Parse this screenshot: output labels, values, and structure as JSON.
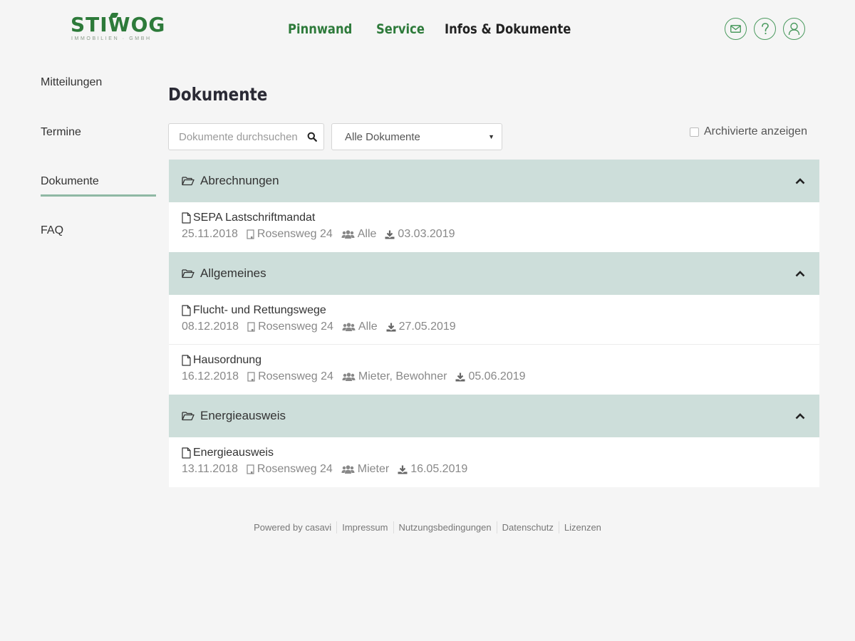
{
  "brand": {
    "logo_text": "STIWOG",
    "logo_subtext": "IMMOBILIEN · GMBH",
    "color": "#2d7a3a"
  },
  "topnav": {
    "items": [
      {
        "label": "Pinnwand"
      },
      {
        "label": "Service"
      },
      {
        "label": "Infos & Dokumente",
        "active": true
      }
    ]
  },
  "header_icons": [
    "mail-icon",
    "help-icon",
    "user-icon"
  ],
  "sidebar": {
    "items": [
      {
        "label": "Mitteilungen"
      },
      {
        "label": "Termine"
      },
      {
        "label": "Dokumente",
        "active": true
      },
      {
        "label": "FAQ"
      }
    ]
  },
  "main": {
    "title": "Dokumente",
    "search": {
      "placeholder": "Dokumente durchsuchen",
      "value": ""
    },
    "filter": {
      "selected": "Alle Dokumente"
    },
    "archive_label": "Archivierte anzeigen",
    "archive_checked": false
  },
  "groups": [
    {
      "name": "Abrechnungen",
      "docs": [
        {
          "title": "SEPA Lastschriftmandat",
          "date": "25.11.2018",
          "property": "Rosensweg 24",
          "audience": "Alle",
          "download": "03.03.2019"
        }
      ]
    },
    {
      "name": "Allgemeines",
      "docs": [
        {
          "title": "Flucht- und Rettungswege",
          "date": "08.12.2018",
          "property": "Rosensweg 24",
          "audience": "Alle",
          "download": "27.05.2019"
        },
        {
          "title": "Hausordnung",
          "date": "16.12.2018",
          "property": "Rosensweg 24",
          "audience": "Mieter, Bewohner",
          "download": "05.06.2019"
        }
      ]
    },
    {
      "name": "Energieausweis",
      "docs": [
        {
          "title": "Energieausweis",
          "date": "13.11.2018",
          "property": "Rosensweg 24",
          "audience": "Mieter",
          "download": "16.05.2019"
        }
      ]
    }
  ],
  "footer": {
    "powered": "Powered by casavi",
    "links": [
      "Impressum",
      "Nutzungsbedingungen",
      "Datenschutz",
      "Lizenzen"
    ]
  },
  "colors": {
    "accent": "#2d7a3a",
    "group_header_bg": "#cddeda",
    "active_underline": "#8fb8a4"
  }
}
